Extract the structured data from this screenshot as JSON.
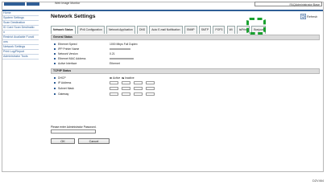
{
  "header": {
    "app_title": "Web Image Monitor",
    "user_id": "FAQAdministrator Base"
  },
  "sidebar": {
    "items": [
      {
        "label": "Home"
      },
      {
        "label": "System Settings"
      },
      {
        "label": "Scan Destination"
      },
      {
        "label": "ID Card Scan Destinatio"
      },
      {
        "label": "n"
      },
      {
        "label": "Restrict Available Functi"
      },
      {
        "label": "ons"
      },
      {
        "label": "Network Settings"
      },
      {
        "label": "Print Log/Report"
      },
      {
        "label": "Administrator Tools"
      }
    ]
  },
  "page": {
    "title": "Network Settings",
    "refresh_label": "Refresh"
  },
  "tabs": [
    {
      "label": "Network Status",
      "active": true
    },
    {
      "label": "IPv6 Configuration",
      "active": false
    },
    {
      "label": "Network Application",
      "active": false
    },
    {
      "label": "DNS",
      "active": false
    },
    {
      "label": "Auto E-mail Notification",
      "active": false
    },
    {
      "label": "SNMP",
      "active": false
    },
    {
      "label": "SMTP",
      "active": false
    },
    {
      "label": "POP3",
      "active": false
    },
    {
      "label": "Wi",
      "active": false
    },
    {
      "label": "IsiPrint",
      "active": false
    },
    {
      "label": "Bonjour",
      "active": false
    }
  ],
  "general_status": {
    "header": "General Status",
    "rows": [
      {
        "label": "Ethernet Speed",
        "value": "1000 Mbps Full Duplex"
      },
      {
        "label": "IPP Printer Name",
        "value": ""
      },
      {
        "label": "Network Version",
        "value": "0.21"
      },
      {
        "label": "Ethernet MAC Address",
        "value": ""
      },
      {
        "label": "Active Interface",
        "value": "Ethernet"
      }
    ]
  },
  "tcpip": {
    "header": "TCP/IP Status",
    "dhcp_label": "DHCP",
    "dhcp_active": "Active",
    "dhcp_inactive": "Inactive",
    "ip_label": "IP Address",
    "subnet_label": "Subnet Mask",
    "gateway_label": "Gateway"
  },
  "password": {
    "label": "Please enter Administrator Password."
  },
  "buttons": {
    "ok": "OK",
    "cancel": "Cancel"
  },
  "figure_code": "DZV464",
  "colors": {
    "accent": "#2f5e96",
    "highlight": "#1aa02f"
  }
}
